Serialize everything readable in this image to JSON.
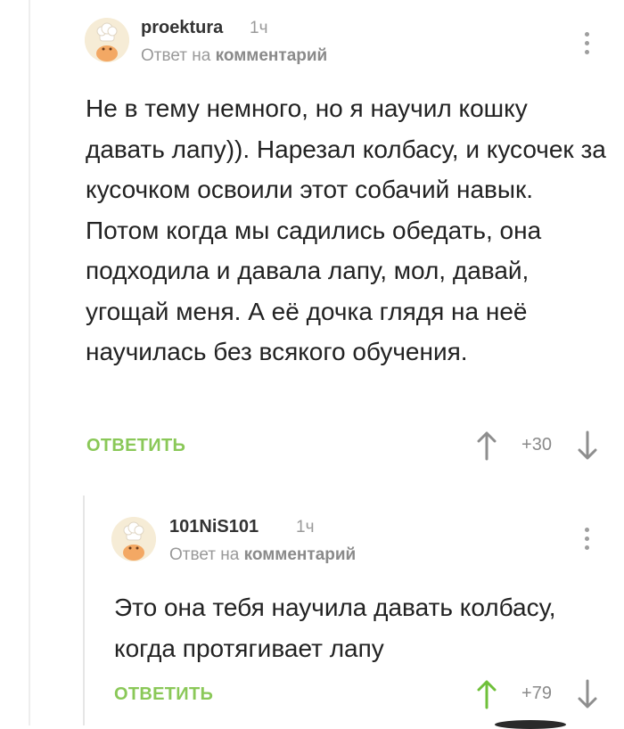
{
  "comments": [
    {
      "author": "proektura",
      "time": "1ч",
      "reply_prefix": "Ответ на",
      "reply_target": "комментарий",
      "text": "Не в тему немного, но я научил кошку давать лапу)). Нарезал колбасу, и кусочек за кусочком освоили этот собачий навык. Потом когда мы садились обедать, она подходила и давала лапу, мол, давай, угощай меня. А её дочка глядя на неё научилась без всякого обучения.",
      "reply_label": "ОТВЕТИТЬ",
      "rating": "+30",
      "upvoted": false
    },
    {
      "author": "101NiS101",
      "time": "1ч",
      "reply_prefix": "Ответ на",
      "reply_target": "комментарий",
      "text": "Это она тебя научила давать колбасу, когда протягивает лапу",
      "reply_label": "ОТВЕТИТЬ",
      "rating": "+79",
      "upvoted": true
    }
  ],
  "colors": {
    "accent_green": "#8ac858",
    "vote_inactive": "#8e8e8e",
    "meta_gray": "#999999"
  },
  "icons": {
    "avatar": "chef-avatar-icon",
    "more": "more-vertical-icon",
    "up": "arrow-up-icon",
    "down": "arrow-down-icon"
  }
}
